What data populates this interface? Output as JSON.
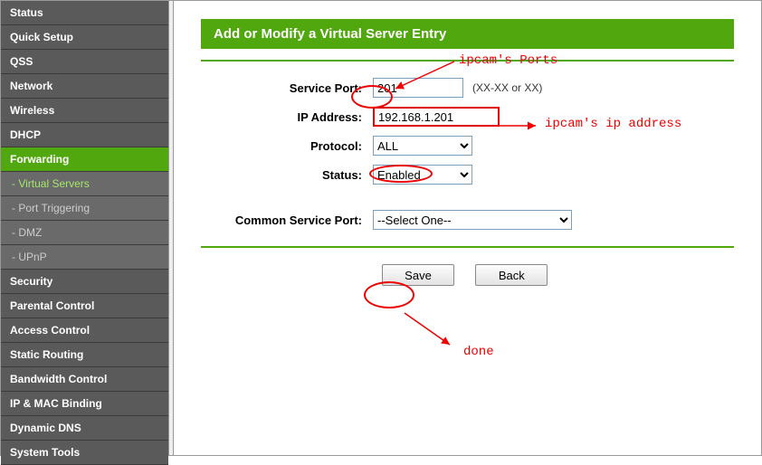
{
  "sidebar": {
    "items": [
      {
        "label": "Status",
        "type": "main"
      },
      {
        "label": "Quick Setup",
        "type": "main"
      },
      {
        "label": "QSS",
        "type": "main"
      },
      {
        "label": "Network",
        "type": "main"
      },
      {
        "label": "Wireless",
        "type": "main"
      },
      {
        "label": "DHCP",
        "type": "main"
      },
      {
        "label": "Forwarding",
        "type": "main",
        "active": true
      },
      {
        "label": "- Virtual Servers",
        "type": "sub",
        "active": true
      },
      {
        "label": "- Port Triggering",
        "type": "sub"
      },
      {
        "label": "- DMZ",
        "type": "sub"
      },
      {
        "label": "- UPnP",
        "type": "sub"
      },
      {
        "label": "Security",
        "type": "main"
      },
      {
        "label": "Parental Control",
        "type": "main"
      },
      {
        "label": "Access Control",
        "type": "main"
      },
      {
        "label": "Static Routing",
        "type": "main"
      },
      {
        "label": "Bandwidth Control",
        "type": "main"
      },
      {
        "label": "IP & MAC Binding",
        "type": "main"
      },
      {
        "label": "Dynamic DNS",
        "type": "main"
      },
      {
        "label": "System Tools",
        "type": "main"
      }
    ]
  },
  "header": {
    "title": "Add or Modify a Virtual Server Entry"
  },
  "form": {
    "service_port": {
      "label": "Service Port:",
      "value": "201",
      "hint": "(XX-XX or XX)"
    },
    "ip_address": {
      "label": "IP Address:",
      "value": "192.168.1.201"
    },
    "protocol": {
      "label": "Protocol:",
      "value": "ALL"
    },
    "status": {
      "label": "Status:",
      "value": "Enabled"
    },
    "common_service": {
      "label": "Common Service Port:",
      "value": "--Select One--"
    }
  },
  "buttons": {
    "save": "Save",
    "back": "Back"
  },
  "annotations": {
    "ports": "ipcam's Ports",
    "ip": "ipcam's ip address",
    "done": "done"
  }
}
